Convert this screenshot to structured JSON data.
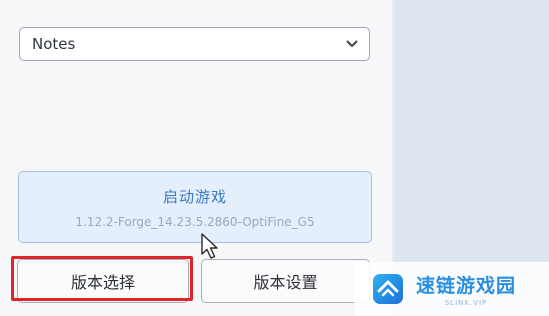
{
  "version_dropdown": {
    "selected": "Notes"
  },
  "launch": {
    "title": "启动游戏",
    "version": "1.12.2-Forge_14.23.5.2860-OptiFine_G5"
  },
  "buttons": {
    "version_select": "版本选择",
    "version_settings": "版本设置"
  },
  "watermark": {
    "name": "速链游戏园",
    "sub": "SLINK.VIP"
  },
  "colors": {
    "accent": "#3a78c4",
    "highlight": "#e1242c",
    "launch_bg": "#e5effb"
  },
  "icons": {
    "dropdown": "chevron-down-icon",
    "cursor": "mouse-cursor-icon",
    "watermark_logo": "watermark-logo-icon"
  }
}
